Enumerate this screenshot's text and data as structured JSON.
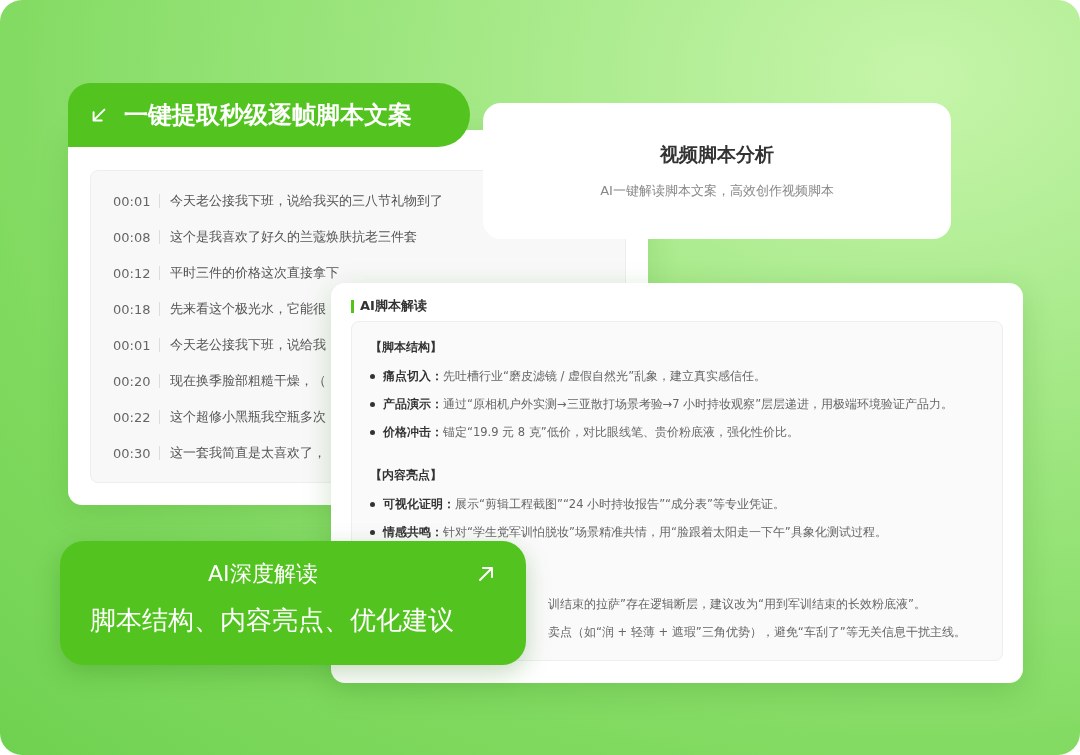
{
  "extract_banner": {
    "title": "一键提取秒级逐帧脚本文案"
  },
  "transcript": [
    {
      "time": "00:01",
      "text": "今天老公接我下班，说给我买的三八节礼物到了"
    },
    {
      "time": "00:08",
      "text": "这个是我喜欢了好久的兰蔻焕肤抗老三件套"
    },
    {
      "time": "00:12",
      "text": "平时三件的价格这次直接拿下"
    },
    {
      "time": "00:18",
      "text": "先来看这个极光水，它能很"
    },
    {
      "time": "00:01",
      "text": "今天老公接我下班，说给我"
    },
    {
      "time": "00:20",
      "text": "现在换季脸部粗糙干燥，（"
    },
    {
      "time": "00:22",
      "text": "这个超修小黑瓶我空瓶多次"
    },
    {
      "time": "00:30",
      "text": "这一套我简直是太喜欢了，"
    }
  ],
  "feature_card": {
    "title": "视频脚本分析",
    "subtitle": "AI一键解读脚本文案，高效创作视频脚本"
  },
  "analysis": {
    "title": "AI脚本解读",
    "sections": [
      {
        "heading": "【脚本结构】",
        "items": [
          {
            "kind": "full",
            "text": "**痛点切入：**先吐槽行业“磨皮滤镜 / 虚假自然光”乱象，建立真实感信任。"
          },
          {
            "kind": "full",
            "text": "**产品演示：**通过“原相机户外实测→三亚散打场景考验→7 小时持妆观察”层层递进，用极端环境验证产品力。"
          },
          {
            "kind": "full",
            "text": "**价格冲击：**锚定“19.9 元 8 克”低价，对比眼线笔、贵价粉底液，强化性价比。"
          }
        ]
      },
      {
        "heading": "【内容亮点】",
        "items": [
          {
            "kind": "full",
            "text": "**可视化证明：**展示“剪辑工程截图”“24 小时持妆报告”“成分表”等专业凭证。"
          },
          {
            "kind": "full",
            "text": "**情感共鸣：**针对“学生党军训怕脱妆”场景精准共情，用“脸跟着太阳走一下午”具象化测试过程。"
          }
        ]
      },
      {
        "items": [
          {
            "kind": "partial",
            "text": "训结束的拉萨”存在逻辑断层，建议改为“用到军训结束的长效粉底液”。"
          },
          {
            "kind": "partial",
            "text": "卖点（如“润 + 轻薄 + 遮瑕”三角优势），避免“车刮了”等无关信息干扰主线。"
          }
        ]
      }
    ]
  },
  "promo_card": {
    "title": "AI深度解读",
    "subtitle": "脚本结构、内容亮点、优化建议"
  }
}
